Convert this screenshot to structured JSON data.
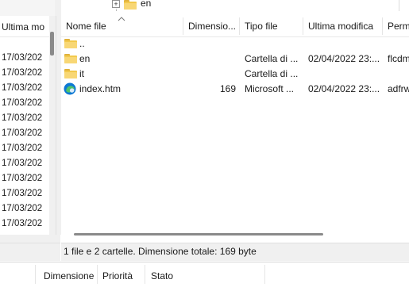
{
  "tree": {
    "expander": "+",
    "folder_label": "en"
  },
  "left_pane": {
    "column_header": "Ultima mo",
    "dates": [
      "17/03/202",
      "17/03/202",
      "17/03/202",
      "17/03/202",
      "17/03/202",
      "17/03/202",
      "17/03/202",
      "17/03/202",
      "17/03/202",
      "17/03/202",
      "17/03/202",
      "17/03/202"
    ]
  },
  "file_list": {
    "columns": [
      "Nome file",
      "Dimensio...",
      "Tipo file",
      "Ultima modifica",
      "Perm"
    ],
    "rows": [
      {
        "icon": "folder-up-icon",
        "name": "..",
        "size": "",
        "type": "",
        "modified": "",
        "perm": ""
      },
      {
        "icon": "folder-icon",
        "name": "en",
        "size": "",
        "type": "Cartella di ...",
        "modified": "02/04/2022 23:...",
        "perm": "flcdm"
      },
      {
        "icon": "folder-icon",
        "name": "it",
        "size": "",
        "type": "Cartella di ...",
        "modified": "",
        "perm": ""
      },
      {
        "icon": "edge-html-icon",
        "name": "index.htm",
        "size": "169",
        "type": "Microsoft ...",
        "modified": "02/04/2022 23:...",
        "perm": "adfrw"
      }
    ]
  },
  "status": {
    "text": "1 file e 2 cartelle. Dimensione totale: 169 byte"
  },
  "queue": {
    "columns": [
      "Dimensione",
      "Priorità",
      "Stato"
    ]
  },
  "colors": {
    "folder": "#f8d775",
    "scroll_thumb": "#8a8a8a",
    "edge_blue": "#0c78d4",
    "edge_green": "#4fc36a"
  }
}
